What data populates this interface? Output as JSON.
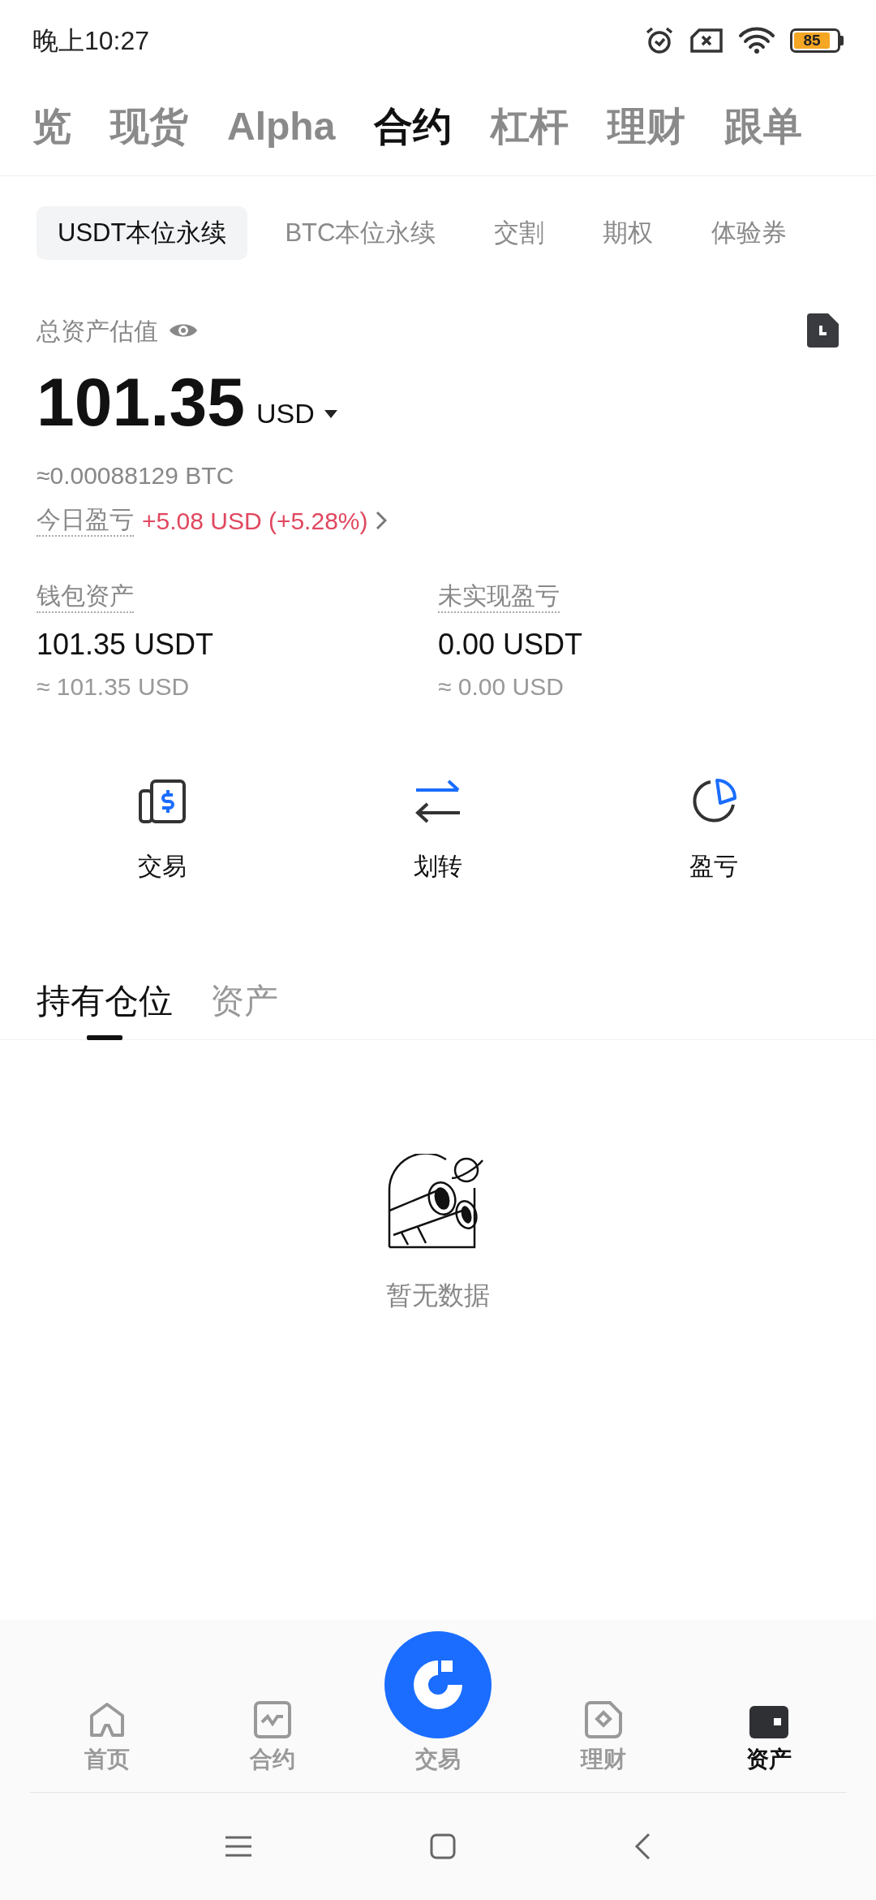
{
  "status_bar": {
    "time": "晚上10:27",
    "battery": "85"
  },
  "top_tabs": [
    {
      "label": "览",
      "selected": false
    },
    {
      "label": "现货",
      "selected": false
    },
    {
      "label": "Alpha",
      "selected": false
    },
    {
      "label": "合约",
      "selected": true
    },
    {
      "label": "杠杆",
      "selected": false
    },
    {
      "label": "理财",
      "selected": false
    },
    {
      "label": "跟单",
      "selected": false
    }
  ],
  "sub_tabs": [
    {
      "label": "USDT本位永续",
      "selected": true
    },
    {
      "label": "BTC本位永续",
      "selected": false
    },
    {
      "label": "交割",
      "selected": false
    },
    {
      "label": "期权",
      "selected": false
    },
    {
      "label": "体验券",
      "selected": false
    }
  ],
  "summary": {
    "title": "总资产估值",
    "amount": "101.35",
    "currency": "USD",
    "btc_value": "≈0.00088129 BTC",
    "pnl_label": "今日盈亏",
    "pnl_value": "+5.08 USD (+5.28%)"
  },
  "stats": [
    {
      "label": "钱包资产",
      "value": "101.35 USDT",
      "approx": "≈ 101.35 USD"
    },
    {
      "label": "未实现盈亏",
      "value": "0.00 USDT",
      "approx": "≈ 0.00 USD"
    }
  ],
  "actions": [
    {
      "kind": "trade",
      "label": "交易"
    },
    {
      "kind": "transfer",
      "label": "划转"
    },
    {
      "kind": "pnl",
      "label": "盈亏"
    }
  ],
  "holding_tabs": [
    {
      "label": "持有仓位",
      "selected": true
    },
    {
      "label": "资产",
      "selected": false
    }
  ],
  "empty_state": {
    "text": "暂无数据"
  },
  "bottom_nav": [
    {
      "kind": "home",
      "label": "首页",
      "selected": false
    },
    {
      "kind": "futures",
      "label": "合约",
      "selected": false
    },
    {
      "kind": "trade",
      "label": "交易",
      "selected": false
    },
    {
      "kind": "earn",
      "label": "理财",
      "selected": false
    },
    {
      "kind": "assets",
      "label": "资产",
      "selected": true
    }
  ]
}
